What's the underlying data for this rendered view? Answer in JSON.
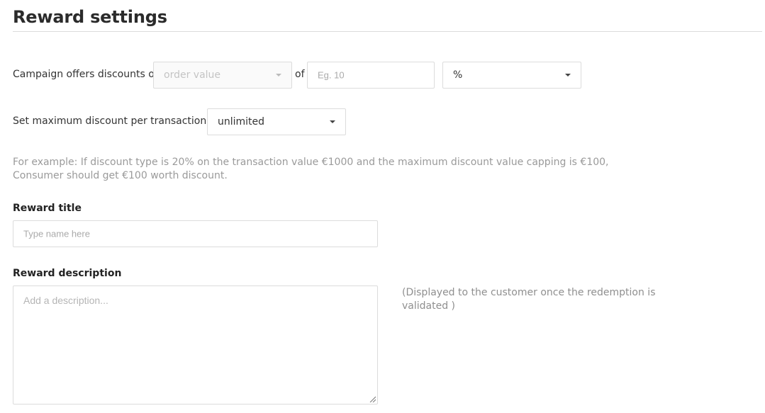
{
  "page": {
    "title": "Reward settings"
  },
  "discount_row": {
    "prefix": "Campaign offers discounts on",
    "basis_select": {
      "value": "order value"
    },
    "of_label": "of",
    "amount_input": {
      "placeholder": "Eg. 10"
    },
    "unit_select": {
      "value": "%"
    }
  },
  "max_row": {
    "label": "Set maximum discount per transaction to",
    "max_select": {
      "value": "unlimited"
    }
  },
  "hint": {
    "line1": "For example: If discount type is 20% on the transaction value €1000 and the maximum discount value capping is €100,",
    "line2": "Consumer should get €100 worth discount."
  },
  "reward_title": {
    "label": "Reward title",
    "placeholder": "Type name here"
  },
  "reward_description": {
    "label": "Reward description",
    "placeholder": "Add a description...",
    "note_line1": "(Displayed to the customer once the redemption is",
    "note_line2": "validated )"
  },
  "icons": {
    "caret": "chevron-down-icon",
    "resize": "resize-grip-icon"
  }
}
